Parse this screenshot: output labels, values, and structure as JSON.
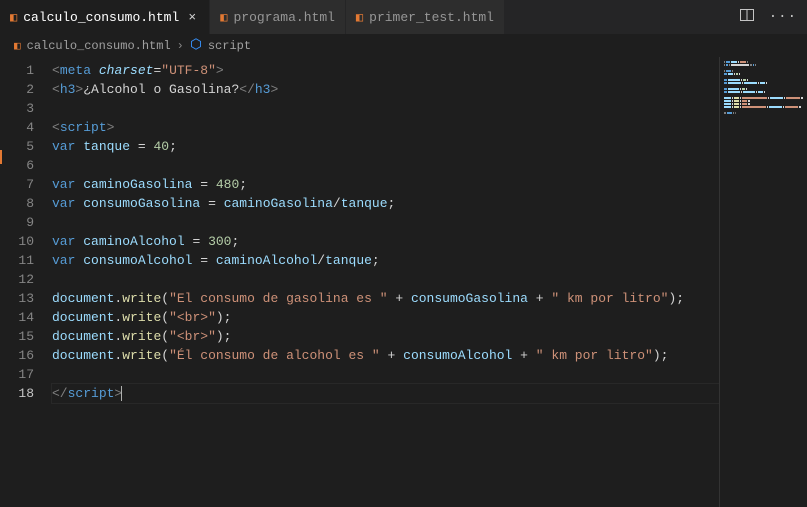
{
  "tabs": [
    {
      "label": "calculo_consumo.html",
      "active": true
    },
    {
      "label": "programa.html",
      "active": false
    },
    {
      "label": "primer_test.html",
      "active": false
    }
  ],
  "breadcrumb": {
    "file": "calculo_consumo.html",
    "symbol": "script"
  },
  "code": {
    "lines": [
      {
        "n": 1,
        "html": "<span class='tk-gray'>&lt;</span><span class='tk-tag'>meta</span> <span class='tk-attr'><i>charset</i></span><span class='tk-text'>=</span><span class='tk-str'>\"UTF-8\"</span><span class='tk-gray'>&gt;</span>"
      },
      {
        "n": 2,
        "html": "<span class='tk-gray'>&lt;</span><span class='tk-tag'>h3</span><span class='tk-gray'>&gt;</span><span class='tk-text'>¿Alcohol o Gasolina?</span><span class='tk-gray'>&lt;/</span><span class='tk-tag'>h3</span><span class='tk-gray'>&gt;</span>"
      },
      {
        "n": 3,
        "html": ""
      },
      {
        "n": 4,
        "html": "<span class='tk-gray'>&lt;</span><span class='tk-tag'>script</span><span class='tk-gray'>&gt;</span>"
      },
      {
        "n": 5,
        "html": "<span class='tk-kw'>var</span> <span class='tk-var'>tanque</span> <span class='tk-text'>=</span> <span class='tk-num'>40</span><span class='tk-text'>;</span>"
      },
      {
        "n": 6,
        "html": ""
      },
      {
        "n": 7,
        "html": "<span class='tk-kw'>var</span> <span class='tk-var'>caminoGasolina</span> <span class='tk-text'>=</span> <span class='tk-num'>480</span><span class='tk-text'>;</span>"
      },
      {
        "n": 8,
        "html": "<span class='tk-kw'>var</span> <span class='tk-var'>consumoGasolina</span> <span class='tk-text'>=</span> <span class='tk-var'>caminoGasolina</span><span class='tk-text'>/</span><span class='tk-var'>tanque</span><span class='tk-text'>;</span>"
      },
      {
        "n": 9,
        "html": ""
      },
      {
        "n": 10,
        "html": "<span class='tk-kw'>var</span> <span class='tk-var'>caminoAlcohol</span> <span class='tk-text'>=</span> <span class='tk-num'>300</span><span class='tk-text'>;</span>"
      },
      {
        "n": 11,
        "html": "<span class='tk-kw'>var</span> <span class='tk-var'>consumoAlcohol</span> <span class='tk-text'>=</span> <span class='tk-var'>caminoAlcohol</span><span class='tk-text'>/</span><span class='tk-var'>tanque</span><span class='tk-text'>;</span>"
      },
      {
        "n": 12,
        "html": ""
      },
      {
        "n": 13,
        "html": "<span class='tk-var'>document</span><span class='tk-text'>.</span><span class='tk-fn'>write</span><span class='tk-text'>(</span><span class='tk-str'>\"El consumo de gasolina es \"</span> <span class='tk-text'>+</span> <span class='tk-var'>consumoGasolina</span> <span class='tk-text'>+</span> <span class='tk-str'>\" km por litro\"</span><span class='tk-text'>);</span>"
      },
      {
        "n": 14,
        "html": "<span class='tk-var'>document</span><span class='tk-text'>.</span><span class='tk-fn'>write</span><span class='tk-text'>(</span><span class='tk-str'>\"&lt;br&gt;\"</span><span class='tk-text'>);</span>"
      },
      {
        "n": 15,
        "html": "<span class='tk-var'>document</span><span class='tk-text'>.</span><span class='tk-fn'>write</span><span class='tk-text'>(</span><span class='tk-str'>\"&lt;br&gt;\"</span><span class='tk-text'>);</span>"
      },
      {
        "n": 16,
        "html": "<span class='tk-var'>document</span><span class='tk-text'>.</span><span class='tk-fn'>write</span><span class='tk-text'>(</span><span class='tk-str'>\"Él consumo de alcohol es \"</span> <span class='tk-text'>+</span> <span class='tk-var'>consumoAlcohol</span> <span class='tk-text'>+</span> <span class='tk-str'>\" km por litro\"</span><span class='tk-text'>);</span>"
      },
      {
        "n": 17,
        "html": ""
      },
      {
        "n": 18,
        "html": "<span class='tk-gray'>&lt;/</span><span class='tk-tag'>script</span><span class='tk-gray'>&gt;</span><span class='caret'></span>",
        "current": true
      }
    ]
  }
}
